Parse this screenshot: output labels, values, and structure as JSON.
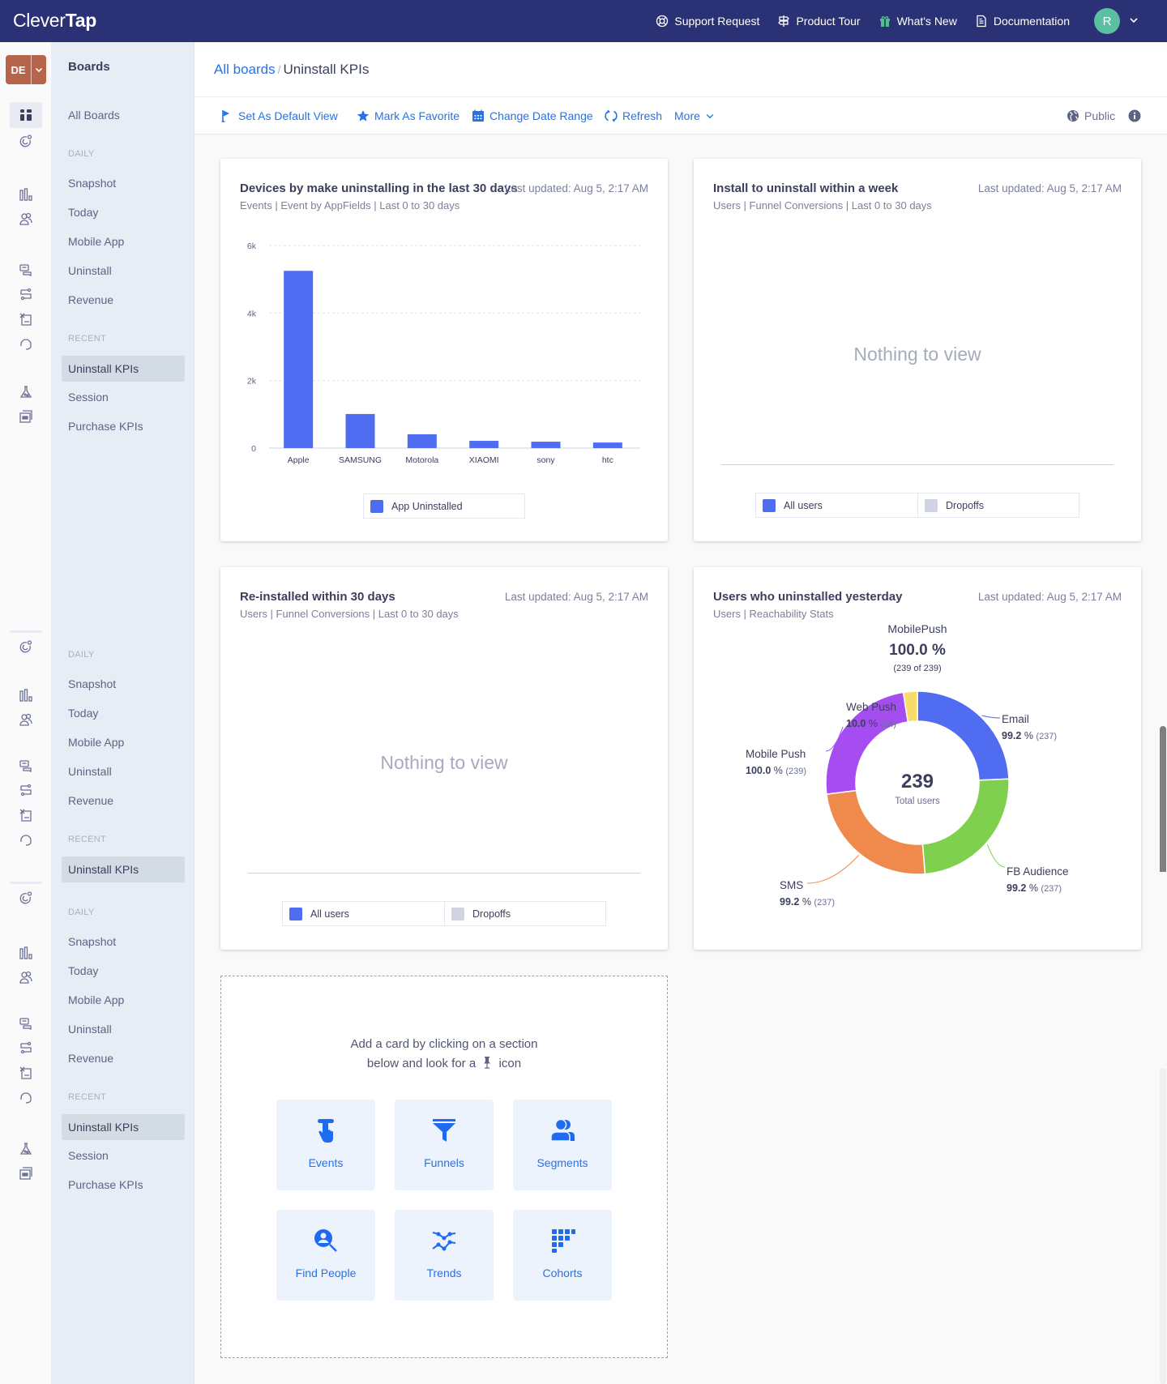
{
  "app": {
    "logo_light": "Clever",
    "logo_bold": "Tap"
  },
  "topnav": {
    "support": "Support Request",
    "tour": "Product Tour",
    "whats_new": "What's New",
    "docs": "Documentation",
    "avatar_initial": "R"
  },
  "account": {
    "initials": "DE"
  },
  "sidebar": {
    "title": "Boards",
    "all_boards": "All Boards",
    "daily_label": "DAILY",
    "recent_label": "RECENT",
    "daily": [
      "Snapshot",
      "Today",
      "Mobile App",
      "Uninstall",
      "Revenue"
    ],
    "recent": [
      "Uninstall KPIs",
      "Session",
      "Purchase KPIs"
    ],
    "selected": "Uninstall KPIs"
  },
  "breadcrumb": {
    "parent": "All boards",
    "separator": "/",
    "current": "Uninstall KPIs"
  },
  "toolbar": {
    "default_view": "Set As Default View",
    "favorite": "Mark As Favorite",
    "date_range": "Change Date Range",
    "refresh": "Refresh",
    "more": "More",
    "visibility": "Public"
  },
  "cards": [
    {
      "title": "Devices by make uninstalling in the last 30 days",
      "subtitle": "Events | Event by AppFields | Last 0 to 30 days",
      "updated": "Last updated: Aug 5, 2:17 AM",
      "legend": [
        "App Uninstalled"
      ]
    },
    {
      "title": "Install to uninstall within a week",
      "subtitle": "Users | Funnel Conversions | Last 0 to 30 days",
      "updated": "Last updated: Aug 5, 2:17 AM",
      "empty": "Nothing to view",
      "legend": [
        "All users",
        "Dropoffs"
      ]
    },
    {
      "title": "Re-installed within 30 days",
      "subtitle": "Users | Funnel Conversions | Last 0 to 30 days",
      "updated": "Last updated: Aug 5, 2:17 AM",
      "empty": "Nothing to view",
      "legend": [
        "All users",
        "Dropoffs"
      ]
    },
    {
      "title": "Users who uninstalled yesterday",
      "subtitle": "Users | Reachability Stats",
      "updated": "Last updated: Aug 5, 2:17 AM"
    }
  ],
  "colors": {
    "primary": "#506cf0",
    "dropoff": "#d0d3e2",
    "email": "#506cf0",
    "fb": "#80d04f",
    "sms": "#f0894c",
    "mobile_push": "#a64df2",
    "web_push": "#f8dc6a"
  },
  "add_card": {
    "line1": "Add a card by clicking on a section",
    "line2_pre": "below and look for a",
    "line2_post": "icon",
    "tiles": [
      "Events",
      "Funnels",
      "Segments",
      "Find People",
      "Trends",
      "Cohorts"
    ]
  },
  "chart_data": [
    {
      "type": "bar",
      "title": "Devices by make uninstalling in the last 30 days",
      "categories": [
        "Apple",
        "SAMSUNG",
        "Motorola",
        "XIAOMI",
        "sony",
        "htc"
      ],
      "series": [
        {
          "name": "App Uninstalled",
          "values": [
            5250,
            1010,
            410,
            215,
            190,
            165
          ]
        }
      ],
      "yticks": [
        0,
        2000,
        4000,
        6000
      ],
      "ytick_labels": [
        "0",
        "2k",
        "4k",
        "6k"
      ],
      "ylim": [
        0,
        6000
      ],
      "grid": true,
      "legend": "bottom"
    },
    {
      "type": "pie",
      "title": "Users who uninstalled yesterday",
      "center_value": "239",
      "center_label": "Total users",
      "headline": {
        "label": "MobilePush",
        "value": "100.0 %",
        "detail": "(239 of 239)"
      },
      "slices": [
        {
          "name": "Email",
          "pct": "99.2 %",
          "count": "(237)",
          "value": 237
        },
        {
          "name": "FB Audience",
          "pct": "99.2 %",
          "count": "(237)",
          "value": 237
        },
        {
          "name": "SMS",
          "pct": "99.2 %",
          "count": "(237)",
          "value": 237
        },
        {
          "name": "Mobile Push",
          "pct": "100.0 %",
          "count": "(239)",
          "value": 239
        },
        {
          "name": "Web Push",
          "pct": "10.0 %",
          "count": "(24)",
          "value": 24
        }
      ]
    }
  ]
}
